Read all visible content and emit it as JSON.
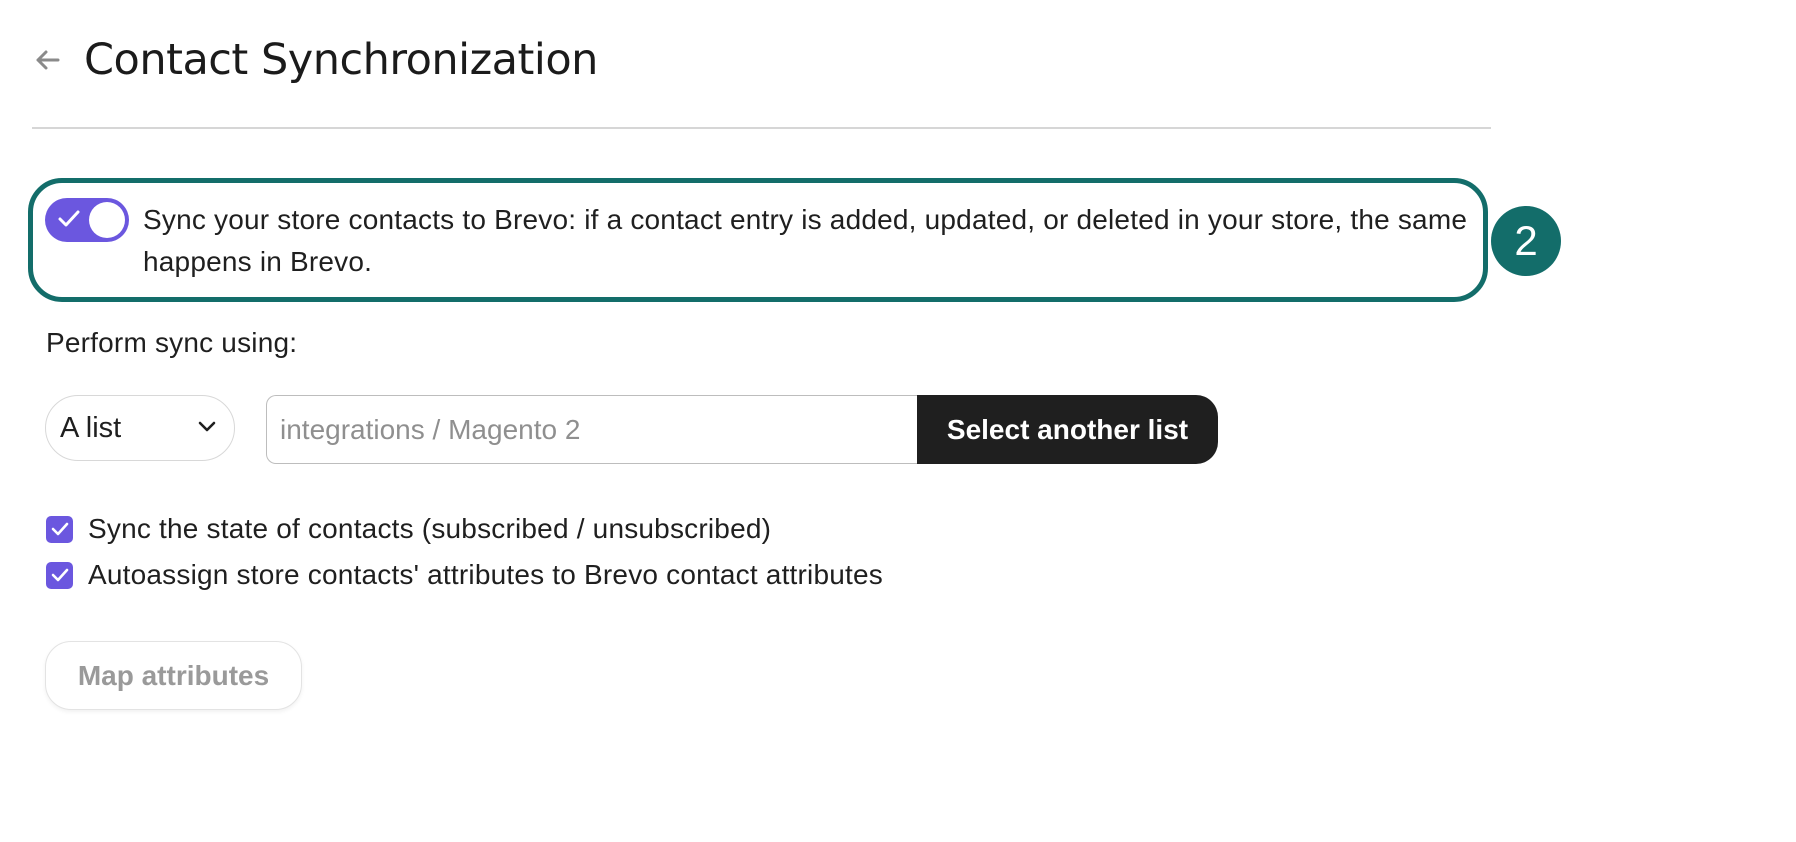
{
  "header": {
    "back_icon": "arrow-left-icon",
    "title": "Contact Synchronization"
  },
  "sync_toggle": {
    "state": "on",
    "description": "Sync your store contacts to Brevo: if a contact entry is added, updated, or deleted in your store, the same happens in Brevo."
  },
  "step_badge": "2",
  "perform": {
    "label": "Perform sync using:",
    "type_select_value": "A list",
    "list_input_placeholder": "integrations / Magento 2",
    "select_button_label": "Select another list"
  },
  "options": [
    {
      "label": "Sync the state of contacts (subscribed / unsubscribed)",
      "checked": true
    },
    {
      "label": "Autoassign store contacts' attributes to Brevo contact attributes",
      "checked": true
    }
  ],
  "map_attributes_label": "Map attributes",
  "colors": {
    "accent": "#6b57df",
    "highlight": "#136d6a",
    "dark_button": "#1f1f1f"
  }
}
